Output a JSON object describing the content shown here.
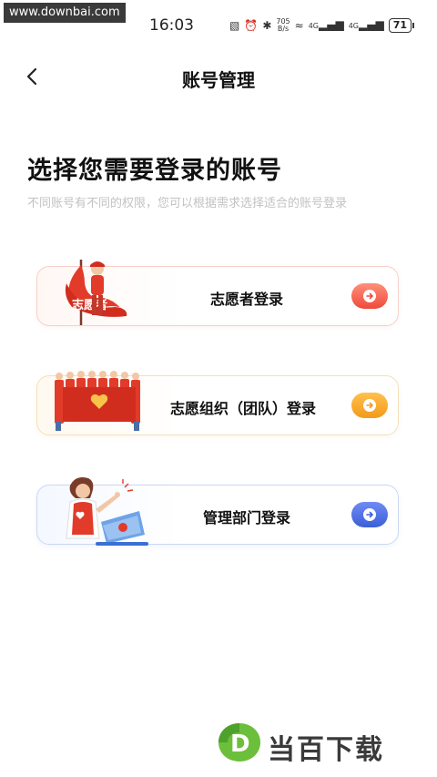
{
  "watermark_top": "www.downbai.com",
  "status_bar": {
    "time": "16:03",
    "net_speed_value": "705",
    "net_speed_unit": "B/s",
    "signal_1": "4G",
    "signal_2": "4G",
    "battery": "71"
  },
  "navbar": {
    "title": "账号管理"
  },
  "page": {
    "heading": "选择您需要登录的账号",
    "subheading": "不同账号有不同的权限，您可以根据需求选择适合的账号登录"
  },
  "cards": [
    {
      "label": "志愿者登录",
      "accent": "#ef4a3a",
      "illustration_text": "志愿者"
    },
    {
      "label": "志愿组织（团队）登录",
      "accent": "#f39a1a"
    },
    {
      "label": "管理部门登录",
      "accent": "#3b5fd6"
    }
  ],
  "watermark_bottom": {
    "logo_letter": "D",
    "text": "当百下载"
  }
}
